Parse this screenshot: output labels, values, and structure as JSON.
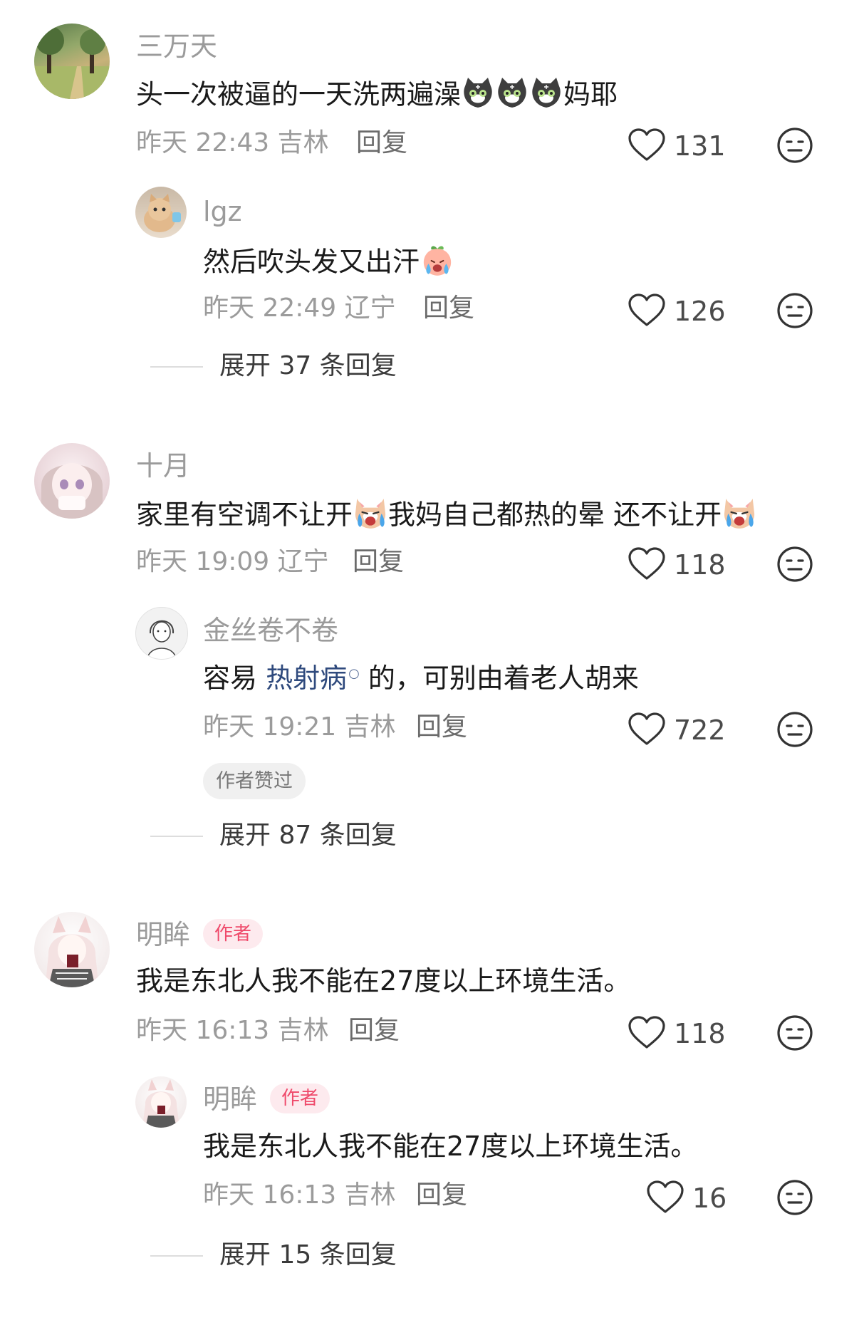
{
  "threads": [
    {
      "comment": {
        "username": "三万天",
        "text_before": "头一次被逼的一天洗两遍澡",
        "emoji": "cat-emoji",
        "text_after": "妈耶",
        "time": "昨天 22:43 吉林",
        "reply_label": "回复",
        "likes": "131"
      },
      "reply": {
        "username": "lgz",
        "text_before": "然后吹头发又出汗",
        "emoji": "crying-peach-emoji",
        "time": "昨天 22:49 辽宁",
        "reply_label": "回复",
        "likes": "126"
      },
      "expand_label": "展开 37 条回复"
    },
    {
      "comment": {
        "username": "十月",
        "text_1": "家里有空调不让开",
        "emoji": "crying-dog-emoji",
        "text_2": "我妈自己都热的晕 还不让开",
        "time": "昨天 19:09 辽宁",
        "reply_label": "回复",
        "likes": "118"
      },
      "reply": {
        "username": "金丝卷不卷",
        "text_before": "容易 ",
        "link": "热射病",
        "text_after": " 的，可别由着老人胡来",
        "time": "昨天 19:21 吉林",
        "reply_label": "回复",
        "likes": "722",
        "badge": "作者赞过"
      },
      "expand_label": "展开 87 条回复"
    },
    {
      "comment": {
        "username": "明眸",
        "tag": "作者",
        "text": "我是东北人我不能在27度以上环境生活。",
        "time": "昨天 16:13 吉林",
        "reply_label": "回复",
        "likes": "118"
      },
      "reply": {
        "username": "明眸",
        "tag": "作者",
        "text": "我是东北人我不能在27度以上环境生活。",
        "time": "昨天 16:13 吉林",
        "reply_label": "回复",
        "likes": "16"
      },
      "expand_label": "展开 15 条回复"
    }
  ],
  "colors": {
    "username": "#9b9b9b",
    "author_tag_bg": "#fdeaee",
    "author_tag_text": "#ef4a6b",
    "link": "#2f4a7d"
  }
}
